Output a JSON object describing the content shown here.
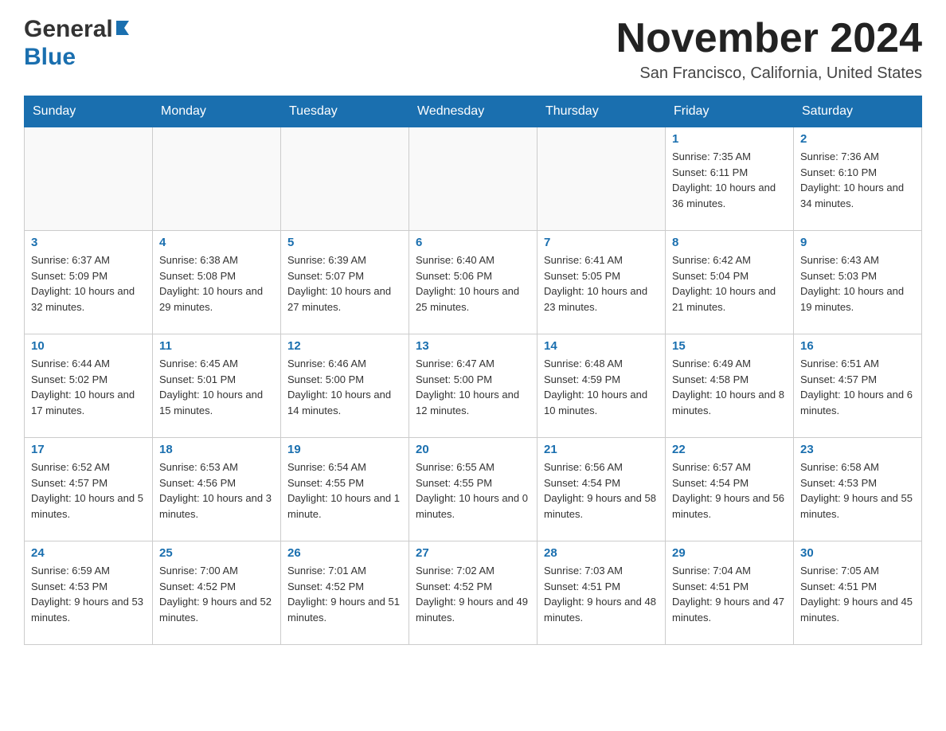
{
  "header": {
    "month_title": "November 2024",
    "location": "San Francisco, California, United States",
    "logo_general": "General",
    "logo_blue": "Blue"
  },
  "calendar": {
    "days_of_week": [
      "Sunday",
      "Monday",
      "Tuesday",
      "Wednesday",
      "Thursday",
      "Friday",
      "Saturday"
    ],
    "weeks": [
      [
        {
          "day": "",
          "info": ""
        },
        {
          "day": "",
          "info": ""
        },
        {
          "day": "",
          "info": ""
        },
        {
          "day": "",
          "info": ""
        },
        {
          "day": "",
          "info": ""
        },
        {
          "day": "1",
          "info": "Sunrise: 7:35 AM\nSunset: 6:11 PM\nDaylight: 10 hours and 36 minutes."
        },
        {
          "day": "2",
          "info": "Sunrise: 7:36 AM\nSunset: 6:10 PM\nDaylight: 10 hours and 34 minutes."
        }
      ],
      [
        {
          "day": "3",
          "info": "Sunrise: 6:37 AM\nSunset: 5:09 PM\nDaylight: 10 hours and 32 minutes."
        },
        {
          "day": "4",
          "info": "Sunrise: 6:38 AM\nSunset: 5:08 PM\nDaylight: 10 hours and 29 minutes."
        },
        {
          "day": "5",
          "info": "Sunrise: 6:39 AM\nSunset: 5:07 PM\nDaylight: 10 hours and 27 minutes."
        },
        {
          "day": "6",
          "info": "Sunrise: 6:40 AM\nSunset: 5:06 PM\nDaylight: 10 hours and 25 minutes."
        },
        {
          "day": "7",
          "info": "Sunrise: 6:41 AM\nSunset: 5:05 PM\nDaylight: 10 hours and 23 minutes."
        },
        {
          "day": "8",
          "info": "Sunrise: 6:42 AM\nSunset: 5:04 PM\nDaylight: 10 hours and 21 minutes."
        },
        {
          "day": "9",
          "info": "Sunrise: 6:43 AM\nSunset: 5:03 PM\nDaylight: 10 hours and 19 minutes."
        }
      ],
      [
        {
          "day": "10",
          "info": "Sunrise: 6:44 AM\nSunset: 5:02 PM\nDaylight: 10 hours and 17 minutes."
        },
        {
          "day": "11",
          "info": "Sunrise: 6:45 AM\nSunset: 5:01 PM\nDaylight: 10 hours and 15 minutes."
        },
        {
          "day": "12",
          "info": "Sunrise: 6:46 AM\nSunset: 5:00 PM\nDaylight: 10 hours and 14 minutes."
        },
        {
          "day": "13",
          "info": "Sunrise: 6:47 AM\nSunset: 5:00 PM\nDaylight: 10 hours and 12 minutes."
        },
        {
          "day": "14",
          "info": "Sunrise: 6:48 AM\nSunset: 4:59 PM\nDaylight: 10 hours and 10 minutes."
        },
        {
          "day": "15",
          "info": "Sunrise: 6:49 AM\nSunset: 4:58 PM\nDaylight: 10 hours and 8 minutes."
        },
        {
          "day": "16",
          "info": "Sunrise: 6:51 AM\nSunset: 4:57 PM\nDaylight: 10 hours and 6 minutes."
        }
      ],
      [
        {
          "day": "17",
          "info": "Sunrise: 6:52 AM\nSunset: 4:57 PM\nDaylight: 10 hours and 5 minutes."
        },
        {
          "day": "18",
          "info": "Sunrise: 6:53 AM\nSunset: 4:56 PM\nDaylight: 10 hours and 3 minutes."
        },
        {
          "day": "19",
          "info": "Sunrise: 6:54 AM\nSunset: 4:55 PM\nDaylight: 10 hours and 1 minute."
        },
        {
          "day": "20",
          "info": "Sunrise: 6:55 AM\nSunset: 4:55 PM\nDaylight: 10 hours and 0 minutes."
        },
        {
          "day": "21",
          "info": "Sunrise: 6:56 AM\nSunset: 4:54 PM\nDaylight: 9 hours and 58 minutes."
        },
        {
          "day": "22",
          "info": "Sunrise: 6:57 AM\nSunset: 4:54 PM\nDaylight: 9 hours and 56 minutes."
        },
        {
          "day": "23",
          "info": "Sunrise: 6:58 AM\nSunset: 4:53 PM\nDaylight: 9 hours and 55 minutes."
        }
      ],
      [
        {
          "day": "24",
          "info": "Sunrise: 6:59 AM\nSunset: 4:53 PM\nDaylight: 9 hours and 53 minutes."
        },
        {
          "day": "25",
          "info": "Sunrise: 7:00 AM\nSunset: 4:52 PM\nDaylight: 9 hours and 52 minutes."
        },
        {
          "day": "26",
          "info": "Sunrise: 7:01 AM\nSunset: 4:52 PM\nDaylight: 9 hours and 51 minutes."
        },
        {
          "day": "27",
          "info": "Sunrise: 7:02 AM\nSunset: 4:52 PM\nDaylight: 9 hours and 49 minutes."
        },
        {
          "day": "28",
          "info": "Sunrise: 7:03 AM\nSunset: 4:51 PM\nDaylight: 9 hours and 48 minutes."
        },
        {
          "day": "29",
          "info": "Sunrise: 7:04 AM\nSunset: 4:51 PM\nDaylight: 9 hours and 47 minutes."
        },
        {
          "day": "30",
          "info": "Sunrise: 7:05 AM\nSunset: 4:51 PM\nDaylight: 9 hours and 45 minutes."
        }
      ]
    ]
  }
}
